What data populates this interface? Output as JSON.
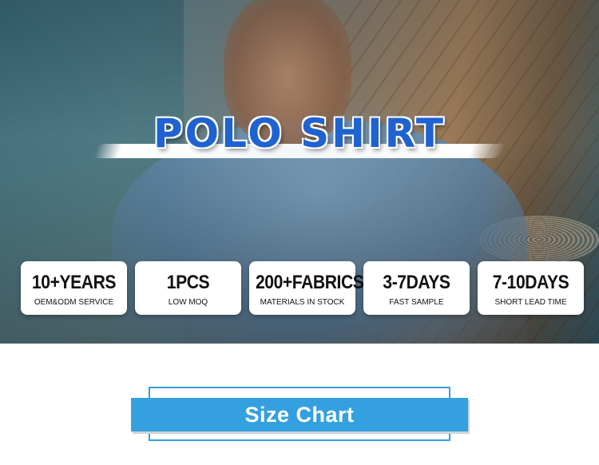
{
  "hero": {
    "title": "POLO SHIRT",
    "title_color": "#1f63d0"
  },
  "stats": [
    {
      "value": "10+YEARS",
      "caption": "OEM&ODM SERVICE"
    },
    {
      "value": "1PCS",
      "caption": "LOW MOQ"
    },
    {
      "value": "200+FABRICS",
      "caption": "MATERIALS IN STOCK"
    },
    {
      "value": "3-7DAYS",
      "caption": "FAST SAMPLE"
    },
    {
      "value": "7-10DAYS",
      "caption": "SHORT LEAD TIME"
    }
  ],
  "section": {
    "label": "Size Chart",
    "accent_color": "#34a0df"
  }
}
